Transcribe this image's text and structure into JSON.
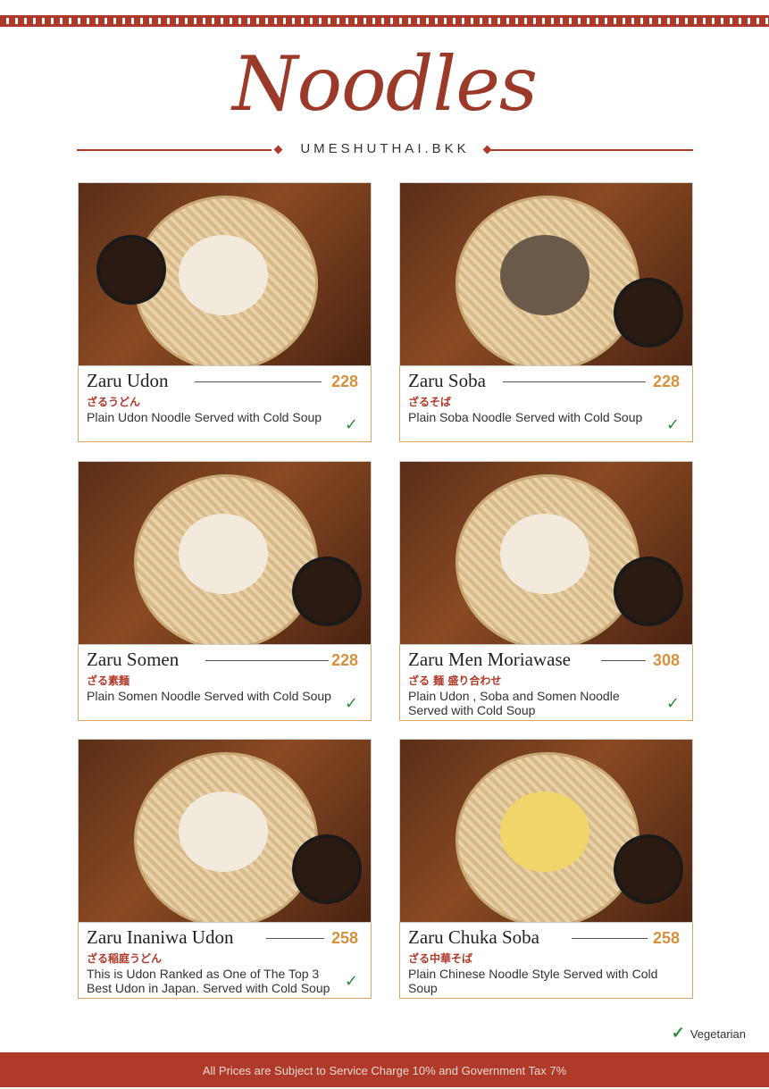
{
  "header": {
    "title": "Noodles",
    "subtitle": "UMESHUTHAI.BKK"
  },
  "items": [
    {
      "name": "Zaru Udon",
      "price": "228",
      "japanese": "ざるうどん",
      "description": "Plain Udon Noodle Served with Cold Soup",
      "vegetarian": true
    },
    {
      "name": "Zaru Soba",
      "price": "228",
      "japanese": "ざるそば",
      "description": "Plain Soba Noodle Served with Cold Soup",
      "vegetarian": true
    },
    {
      "name": "Zaru Somen",
      "price": "228",
      "japanese": "ざる素麺",
      "description": "Plain Somen Noodle Served with Cold Soup",
      "vegetarian": true
    },
    {
      "name": "Zaru Men Moriawase",
      "price": "308",
      "japanese": "ざる 麺 盛り合わせ",
      "description": "Plain Udon , Soba and Somen Noodle Served with Cold Soup",
      "vegetarian": true
    },
    {
      "name": "Zaru Inaniwa Udon",
      "price": "258",
      "japanese": "ざる稲庭うどん",
      "description": "This is Udon Ranked as One of The Top 3 Best Udon in Japan. Served with Cold Soup",
      "vegetarian": true
    },
    {
      "name": "Zaru Chuka Soba",
      "price": "258",
      "japanese": "ざる中華そば",
      "description": "Plain Chinese Noodle Style Served with Cold Soup",
      "vegetarian": false
    }
  ],
  "legend": {
    "label": "Vegetarian",
    "icon": "leaf-icon"
  },
  "footer": {
    "text": "All Prices are Subject to Service Charge 10% and Government Tax 7%"
  },
  "colors": {
    "brand": "#b03a2a",
    "price": "#d6913e",
    "veg": "#2e8b3a"
  }
}
